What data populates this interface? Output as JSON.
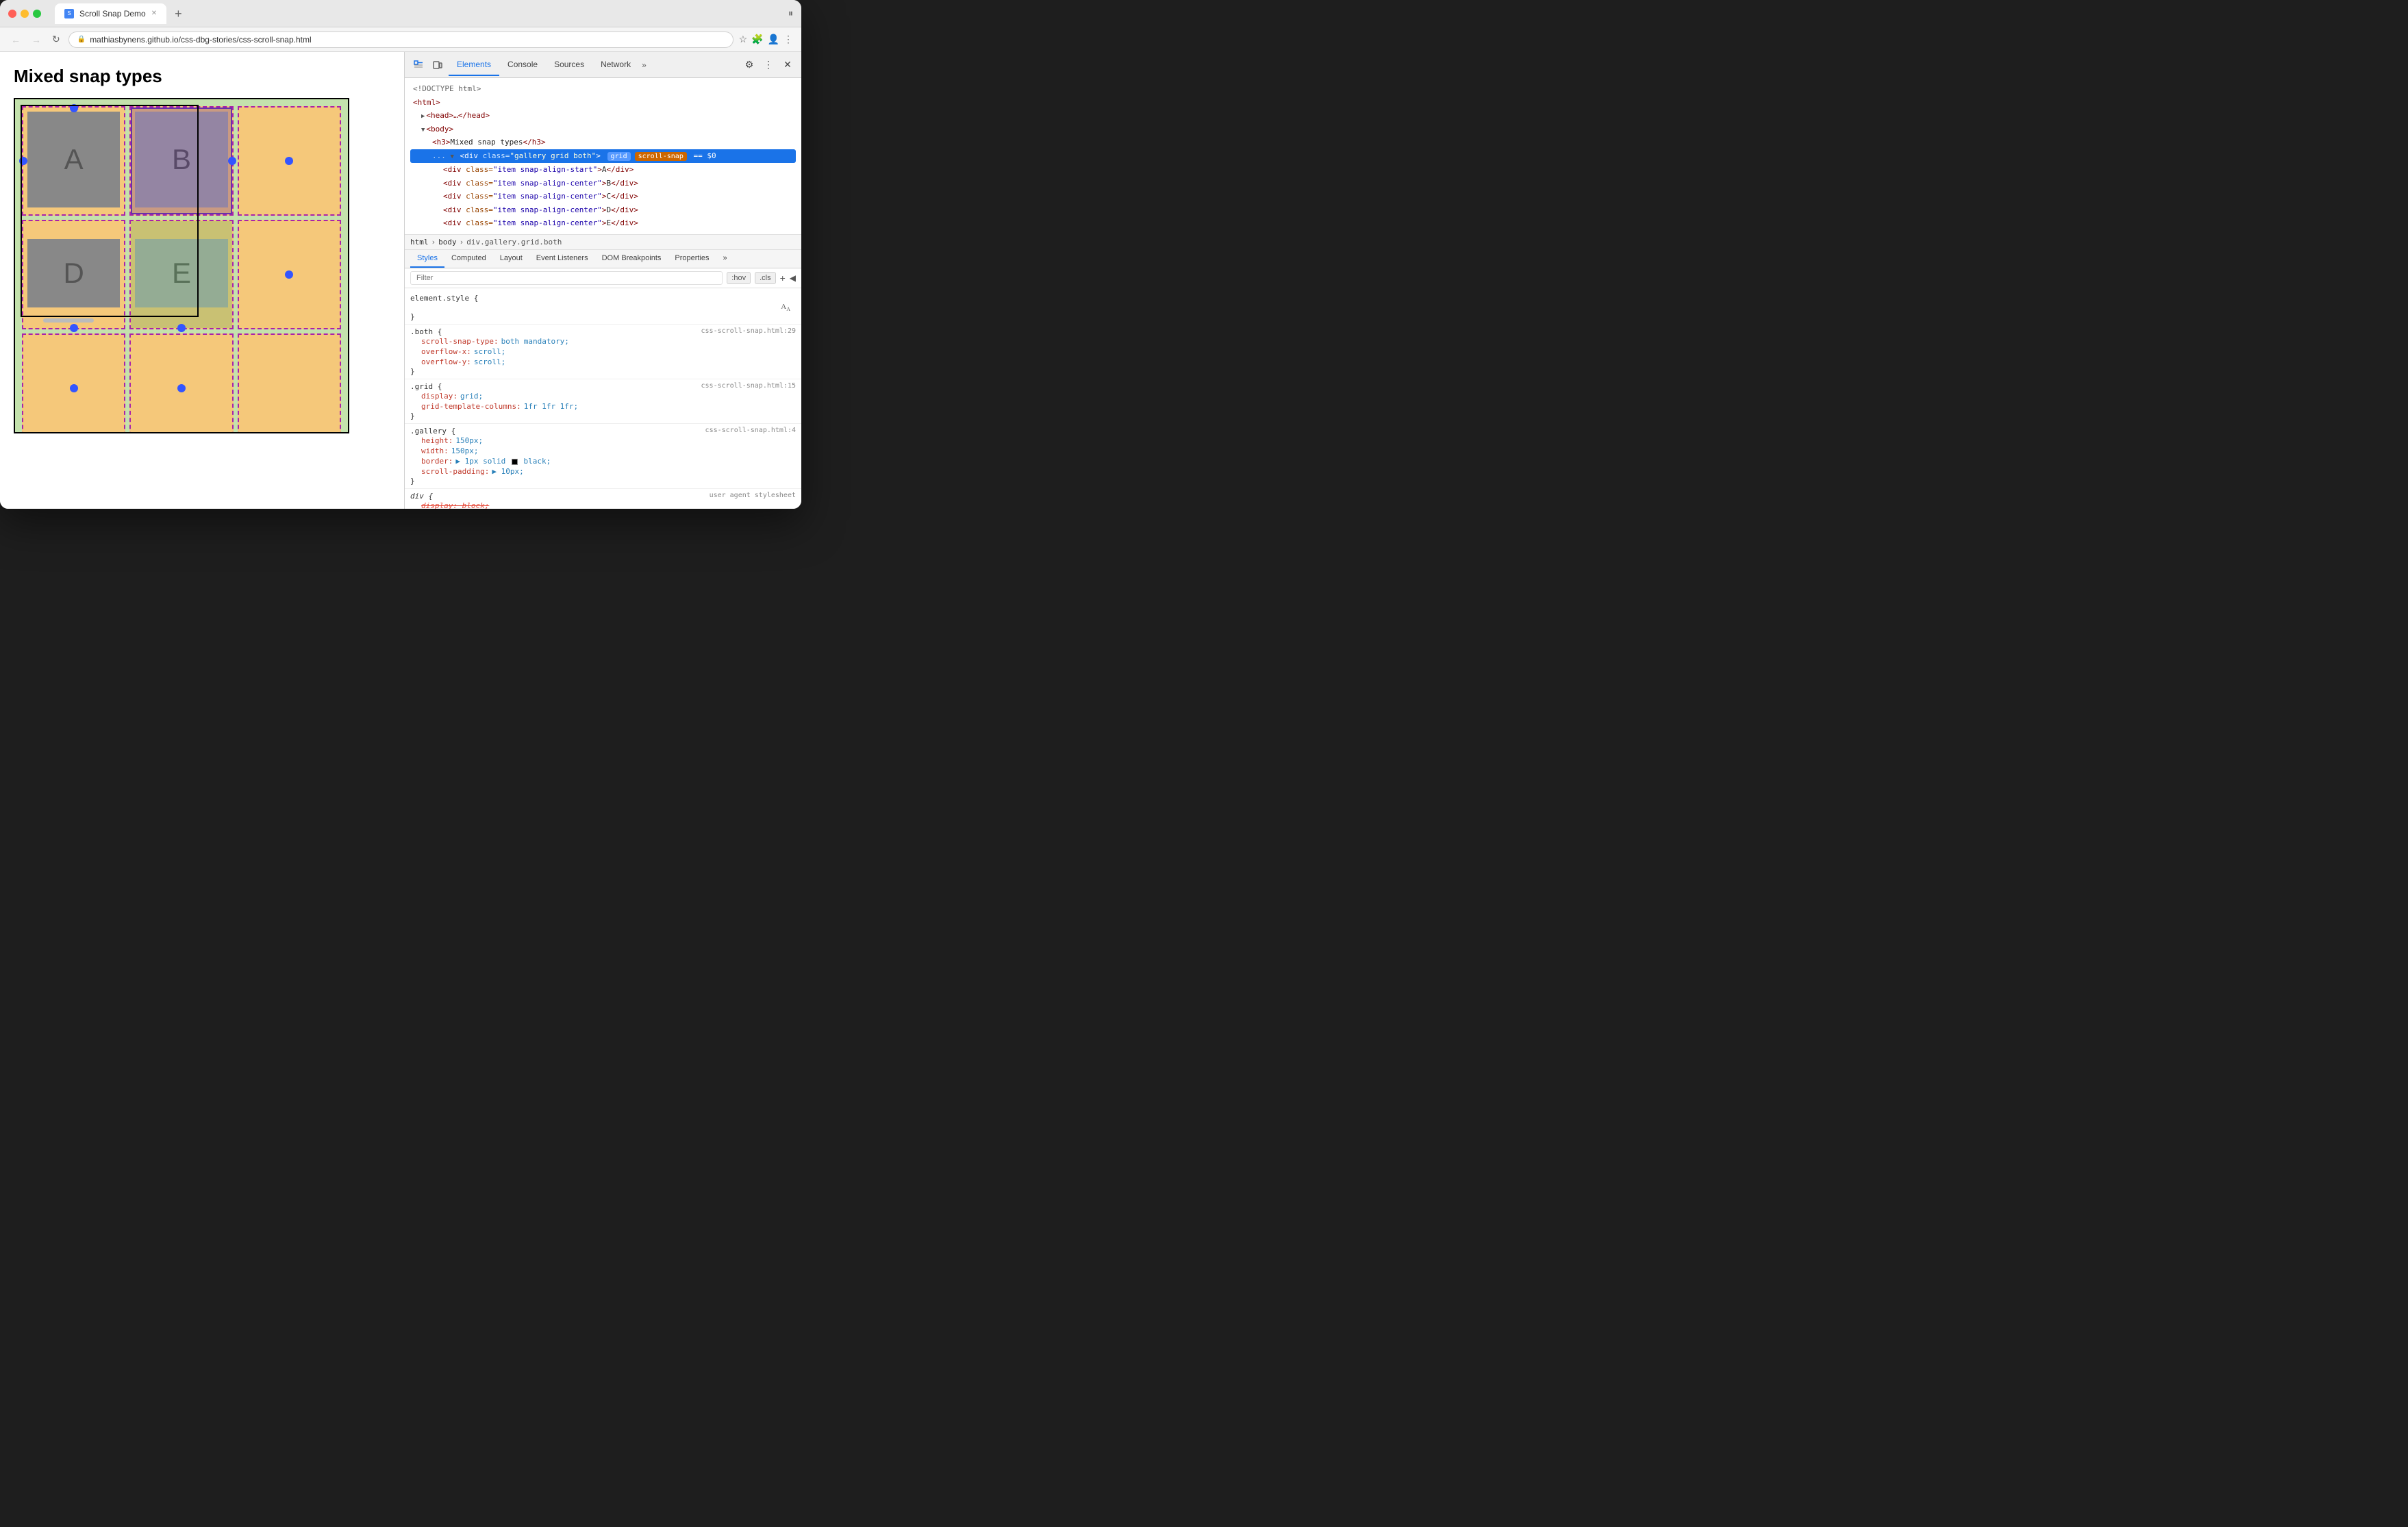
{
  "browser": {
    "title": "Scroll Snap Demo",
    "url": "mathiasbynens.github.io/css-dbg-stories/css-scroll-snap.html",
    "tab_label": "Scroll Snap Demo",
    "new_tab_btn": "+",
    "nav": {
      "back": "←",
      "forward": "→",
      "refresh": "↻"
    }
  },
  "page": {
    "title": "Mixed snap types"
  },
  "devtools": {
    "tabs": [
      "Elements",
      "Console",
      "Sources",
      "Network"
    ],
    "active_tab": "Elements",
    "more_tabs": "»",
    "dom": {
      "lines": [
        {
          "text": "<!DOCTYPE html>",
          "indent": 0,
          "type": "doctype"
        },
        {
          "text": "<html>",
          "indent": 0,
          "type": "tag"
        },
        {
          "text": "▶ <head>…</head>",
          "indent": 1,
          "type": "collapsed"
        },
        {
          "text": "▼ <body>",
          "indent": 1,
          "type": "open"
        },
        {
          "text": "<h3>Mixed snap types</h3>",
          "indent": 2,
          "type": "tag"
        },
        {
          "text": "... ▼ <div class=\"gallery grid both\">",
          "indent": 2,
          "type": "selected",
          "badges": [
            "grid",
            "scroll-snap"
          ],
          "suffix": "== $0"
        },
        {
          "text": "<div class=\"item snap-align-start\">A</div>",
          "indent": 3,
          "type": "tag"
        },
        {
          "text": "<div class=\"item snap-align-center\">B</div>",
          "indent": 3,
          "type": "tag"
        },
        {
          "text": "<div class=\"item snap-align-center\">C</div>",
          "indent": 3,
          "type": "tag"
        },
        {
          "text": "<div class=\"item snap-align-center\">D</div>",
          "indent": 3,
          "type": "tag"
        },
        {
          "text": "<div class=\"item snap-align-center\">E</div>",
          "indent": 3,
          "type": "tag"
        }
      ]
    },
    "breadcrumb": [
      "html",
      "body",
      "div.gallery.grid.both"
    ],
    "styles_tabs": [
      "Styles",
      "Computed",
      "Layout",
      "Event Listeners",
      "DOM Breakpoints",
      "Properties"
    ],
    "active_styles_tab": "Styles",
    "filter_placeholder": "Filter",
    "filter_hov": ":hov",
    "filter_cls": ".cls",
    "css_rules": [
      {
        "selector": "element.style {",
        "close": "}",
        "source": "",
        "props": [],
        "italic": false
      },
      {
        "selector": ".both {",
        "close": "}",
        "source": "css-scroll-snap.html:29",
        "props": [
          {
            "name": "scroll-snap-type:",
            "value": "both mandatory;"
          },
          {
            "name": "overflow-x:",
            "value": "scroll;"
          },
          {
            "name": "overflow-y:",
            "value": "scroll;"
          }
        ],
        "italic": false
      },
      {
        "selector": ".grid {",
        "close": "}",
        "source": "css-scroll-snap.html:15",
        "props": [
          {
            "name": "display:",
            "value": "grid;"
          },
          {
            "name": "grid-template-columns:",
            "value": "1fr 1fr 1fr;"
          }
        ],
        "italic": false
      },
      {
        "selector": ".gallery {",
        "close": "}",
        "source": "css-scroll-snap.html:4",
        "props": [
          {
            "name": "height:",
            "value": "150px;"
          },
          {
            "name": "width:",
            "value": "150px;"
          },
          {
            "name": "border:",
            "value": "▶ 1px solid ■ black;"
          },
          {
            "name": "scroll-padding:",
            "value": "▶ 10px;"
          }
        ],
        "italic": false
      },
      {
        "selector": "div {",
        "close": "}",
        "source": "user agent stylesheet",
        "props": [
          {
            "name": "display:",
            "value": "block;",
            "strikethrough": true
          }
        ],
        "italic": true
      }
    ]
  }
}
